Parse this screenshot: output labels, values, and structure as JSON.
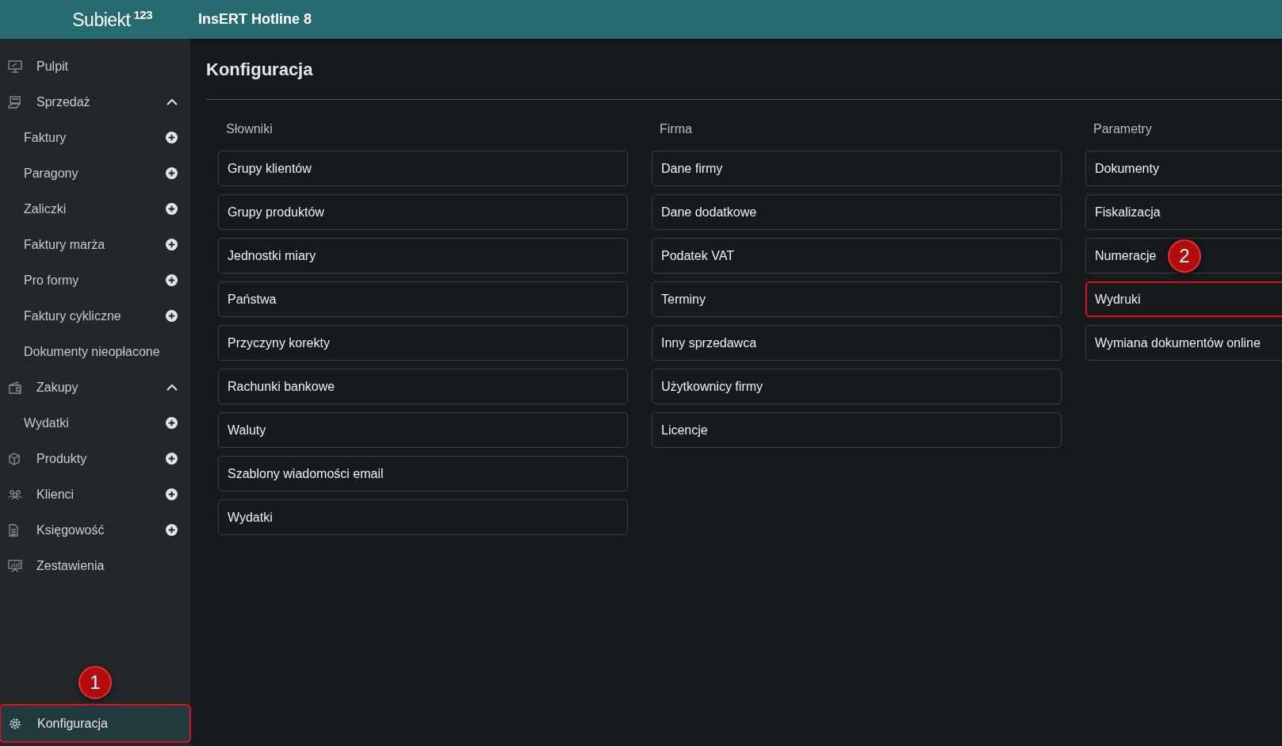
{
  "topbar": {
    "logo": "Subiekt",
    "logo_sup": "123",
    "title": "InsERT Hotline 8"
  },
  "sidebar": {
    "items": [
      {
        "label": "Pulpit",
        "kind": "section",
        "selected": false,
        "highlighted": false
      },
      {
        "label": "Sprzedaż",
        "kind": "section",
        "selected": false,
        "highlighted": false,
        "expanded": true,
        "children": [
          {
            "label": "Faktury",
            "kind": "sub",
            "add": true
          },
          {
            "label": "Paragony",
            "kind": "sub",
            "add": true
          },
          {
            "label": "Zaliczki",
            "kind": "sub",
            "add": true
          },
          {
            "label": "Faktury marża",
            "kind": "sub",
            "add": true
          },
          {
            "label": "Pro formy",
            "kind": "sub",
            "add": true
          },
          {
            "label": "Faktury cykliczne",
            "kind": "sub",
            "add": true
          },
          {
            "label": "Dokumenty nieopłacone",
            "kind": "sub",
            "add": false
          }
        ]
      },
      {
        "label": "Zakupy",
        "kind": "section",
        "selected": false,
        "highlighted": false,
        "expanded": true,
        "children": [
          {
            "label": "Wydatki",
            "kind": "sub",
            "add": true
          }
        ]
      },
      {
        "label": "Produkty",
        "kind": "section",
        "selected": false,
        "highlighted": false,
        "add": true
      },
      {
        "label": "Klienci",
        "kind": "section",
        "selected": false,
        "highlighted": false,
        "add": true
      },
      {
        "label": "Księgowość",
        "kind": "section",
        "selected": false,
        "highlighted": false,
        "add": true
      },
      {
        "label": "Zestawienia",
        "kind": "section",
        "selected": false,
        "highlighted": false
      }
    ],
    "bottom": {
      "label": "Konfiguracja",
      "selected": true,
      "highlighted": true,
      "callout": "1"
    }
  },
  "page": {
    "title": "Konfiguracja",
    "columns": [
      {
        "heading": "Słowniki",
        "items": [
          {
            "label": "Grupy klientów",
            "highlighted": false
          },
          {
            "label": "Grupy produktów",
            "highlighted": false
          },
          {
            "label": "Jednostki miary",
            "highlighted": false
          },
          {
            "label": "Państwa",
            "highlighted": false
          },
          {
            "label": "Przyczyny korekty",
            "highlighted": false
          },
          {
            "label": "Rachunki bankowe",
            "highlighted": false
          },
          {
            "label": "Waluty",
            "highlighted": false
          },
          {
            "label": "Szablony wiadomości email",
            "highlighted": false
          },
          {
            "label": "Wydatki",
            "highlighted": false
          }
        ]
      },
      {
        "heading": "Firma",
        "items": [
          {
            "label": "Dane firmy",
            "highlighted": false
          },
          {
            "label": "Dane dodatkowe",
            "highlighted": false
          },
          {
            "label": "Podatek VAT",
            "highlighted": false
          },
          {
            "label": "Terminy",
            "highlighted": false
          },
          {
            "label": "Inny sprzedawca",
            "highlighted": false
          },
          {
            "label": "Użytkownicy firmy",
            "highlighted": false
          },
          {
            "label": "Licencje",
            "highlighted": false
          }
        ]
      },
      {
        "heading": "Parametry",
        "items": [
          {
            "label": "Dokumenty",
            "highlighted": false
          },
          {
            "label": "Fiskalizacja",
            "highlighted": false
          },
          {
            "label": "Numeracje",
            "highlighted": false,
            "callout": "2"
          },
          {
            "label": "Wydruki",
            "highlighted": true
          },
          {
            "label": "Wymiana dokumentów online",
            "highlighted": false
          }
        ]
      }
    ]
  }
}
